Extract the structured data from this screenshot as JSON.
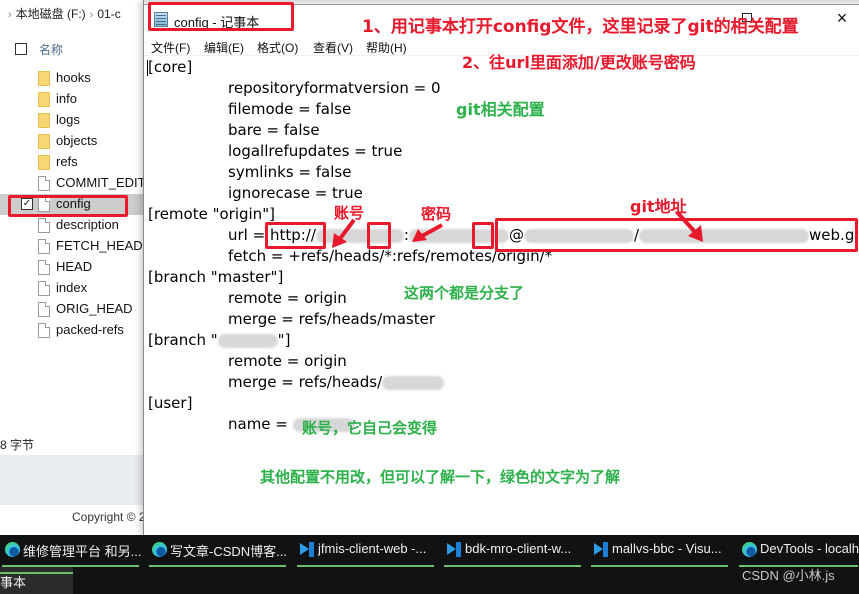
{
  "explorer": {
    "breadcrumb": [
      "本地磁盘 (F:)",
      "01-c"
    ],
    "column_header": "名称",
    "files": [
      {
        "name": "hooks",
        "type": "folder"
      },
      {
        "name": "info",
        "type": "folder"
      },
      {
        "name": "logs",
        "type": "folder"
      },
      {
        "name": "objects",
        "type": "folder"
      },
      {
        "name": "refs",
        "type": "folder"
      },
      {
        "name": "COMMIT_EDITMSG",
        "type": "file"
      },
      {
        "name": "config",
        "type": "file",
        "selected": true
      },
      {
        "name": "description",
        "type": "file"
      },
      {
        "name": "FETCH_HEAD",
        "type": "file"
      },
      {
        "name": "HEAD",
        "type": "file"
      },
      {
        "name": "index",
        "type": "file"
      },
      {
        "name": "ORIG_HEAD",
        "type": "file"
      },
      {
        "name": "packed-refs",
        "type": "file"
      }
    ],
    "status": "8 字节",
    "copyright": "Copyright © 2"
  },
  "notepad": {
    "title": "config - 记事本",
    "menu": [
      "文件(F)",
      "编辑(E)",
      "格式(O)",
      "查看(V)",
      "帮助(H)"
    ],
    "close_label": "×",
    "lines": {
      "core": "[core]",
      "repoformat": "repositoryformatversion = 0",
      "filemode": "filemode = false",
      "bare": "bare = false",
      "logallrefupdates": "logallrefupdates = true",
      "symlinks": "symlinks = false",
      "ignorecase": "ignorecase = true",
      "remote": "[remote \"origin\"]",
      "url_prefix": "url = ",
      "url_scheme": "http://",
      "url_colon": ":",
      "url_at": "@",
      "url_slash": "/",
      "url_suffix": "web.git",
      "fetch": "fetch = +refs/heads/*:refs/remotes/origin/*",
      "branch_master": "[branch \"master\"]",
      "remote_origin": "remote = origin",
      "merge_master": "merge = refs/heads/master",
      "branch_other_prefix": "[branch \"",
      "branch_other_suffix": "\"]",
      "remote_origin2": "remote = origin",
      "merge_other_prefix": "merge = refs/heads/",
      "user": "[user]",
      "name_prefix": "name = "
    }
  },
  "annotations": {
    "step1": "1、用记事本打开config文件，这里记录了git的相关配置",
    "step2": "2、往url里面添加/更改账号密码",
    "git_config": "git相关配置",
    "account": "账号",
    "password": "密码",
    "git_address": "git地址",
    "branches": "这两个都是分支了",
    "user_name": "账号，它自己会变得",
    "footer": "其他配置不用改，但可以了解一下，绿色的文字为了解",
    "colors": {
      "red": "#e8192c",
      "green": "#2db14b"
    }
  },
  "taskbar": {
    "items": [
      {
        "label": "维修管理平台 和另...",
        "icon": "edge-icon"
      },
      {
        "label": "写文章-CSDN博客...",
        "icon": "edge-icon"
      },
      {
        "label": "jfmis-client-web -...",
        "icon": "vscode-icon"
      },
      {
        "label": "bdk-mro-client-w...",
        "icon": "vscode-icon"
      },
      {
        "label": "mallvs-bbc - Visu...",
        "icon": "vscode-icon"
      },
      {
        "label": "DevTools - localh",
        "icon": "edge-icon"
      }
    ],
    "active_item": "记事本",
    "watermark": "CSDN @小林.js"
  }
}
